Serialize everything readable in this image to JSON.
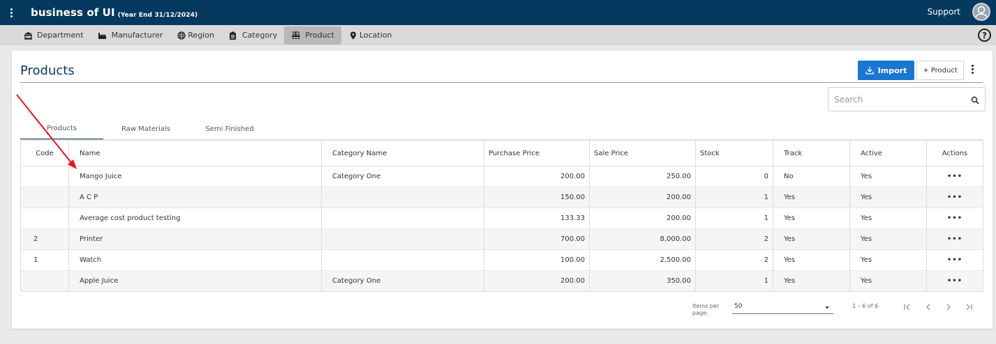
{
  "header": {
    "app_title": "business of UI",
    "app_subtitle": "(Year End 31/12/2024)",
    "support_label": "Support"
  },
  "nav": {
    "items": [
      {
        "label": "Department",
        "icon": "building-icon"
      },
      {
        "label": "Manufacturer",
        "icon": "factory-icon"
      },
      {
        "label": "Region",
        "icon": "globe-icon"
      },
      {
        "label": "Category",
        "icon": "clipboard-icon"
      },
      {
        "label": "Product",
        "icon": "conveyor-icon",
        "active": true
      },
      {
        "label": "Location",
        "icon": "map-pin-icon"
      }
    ],
    "help_label": "?"
  },
  "page": {
    "title": "Products",
    "import_label": "Import",
    "add_product_label": "+ Product"
  },
  "search": {
    "placeholder": "Search"
  },
  "tabs": [
    {
      "label": "Products",
      "active": true
    },
    {
      "label": "Raw Materials"
    },
    {
      "label": "Semi Finished"
    }
  ],
  "table": {
    "columns": [
      "Code",
      "Name",
      "Category Name",
      "Purchase Price",
      "Sale Price",
      "Stock",
      "Track",
      "Active",
      "Actions"
    ],
    "rows": [
      {
        "code": "",
        "name": "Mango Juice",
        "category": "Category One",
        "purchase": "200.00",
        "sale": "250.00",
        "stock": "0",
        "track": "No",
        "active": "Yes",
        "actions": "•••"
      },
      {
        "code": "",
        "name": "A C P",
        "category": "",
        "purchase": "150.00",
        "sale": "200.00",
        "stock": "1",
        "track": "Yes",
        "active": "Yes",
        "actions": "•••"
      },
      {
        "code": "",
        "name": "Average cost product testing",
        "category": "",
        "purchase": "133.33",
        "sale": "200.00",
        "stock": "1",
        "track": "Yes",
        "active": "Yes",
        "actions": "•••"
      },
      {
        "code": "2",
        "name": "Printer",
        "category": "",
        "purchase": "700.00",
        "sale": "8,000.00",
        "stock": "2",
        "track": "Yes",
        "active": "Yes",
        "actions": "•••"
      },
      {
        "code": "1",
        "name": "Watch",
        "category": "",
        "purchase": "100.00",
        "sale": "2,500.00",
        "stock": "2",
        "track": "Yes",
        "active": "Yes",
        "actions": "•••"
      },
      {
        "code": "",
        "name": "Apple Juice",
        "category": "Category One",
        "purchase": "200.00",
        "sale": "350.00",
        "stock": "1",
        "track": "Yes",
        "active": "Yes",
        "actions": "•••"
      }
    ]
  },
  "paginator": {
    "items_per_page_label": "Items per page:",
    "items_per_page_value": "50",
    "range_label": "1 – 6 of 6"
  },
  "colors": {
    "header_bg": "#05395f",
    "accent": "#1976d2",
    "annotation_arrow": "#e8141b"
  }
}
